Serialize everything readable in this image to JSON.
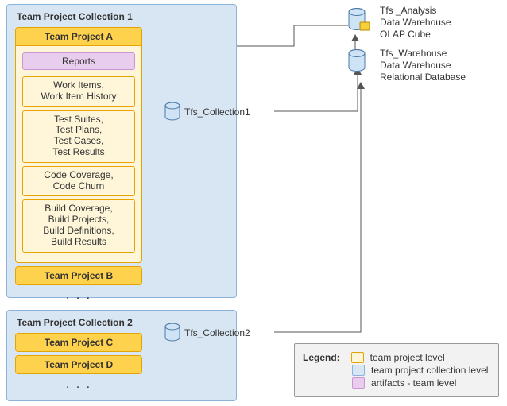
{
  "collections": [
    {
      "title": "Team Project Collection 1",
      "projects": [
        "Team Project A",
        "Team Project B"
      ],
      "innerProject": {
        "artifact": "Reports",
        "dataBoxes": [
          "Work Items,\nWork Item History",
          "Test Suites,\nTest Plans,\nTest Cases,\nTest Results",
          "Code Coverage,\nCode Churn",
          "Build Coverage,\nBuild Projects,\nBuild Definitions,\nBuild Results"
        ]
      },
      "dbLabel": "Tfs_Collection1"
    },
    {
      "title": "Team Project Collection 2",
      "projects": [
        "Team Project C",
        "Team Project D"
      ],
      "dbLabel": "Tfs_Collection2"
    }
  ],
  "ellipsis": ". . .",
  "databases": [
    {
      "label": "Tfs _Analysis\nData Warehouse\nOLAP Cube"
    },
    {
      "label": "Tfs_Warehouse\nData Warehouse\nRelational Database"
    }
  ],
  "legend": {
    "title": "Legend:",
    "items": [
      {
        "label": "team project level",
        "color": "#fff6d9",
        "border": "#e6a400"
      },
      {
        "label": "team project collection level",
        "color": "#d8e6f3",
        "border": "#8bb3db"
      },
      {
        "label": "artifacts - team level",
        "color": "#e8cdee",
        "border": "#c996d0"
      }
    ]
  }
}
